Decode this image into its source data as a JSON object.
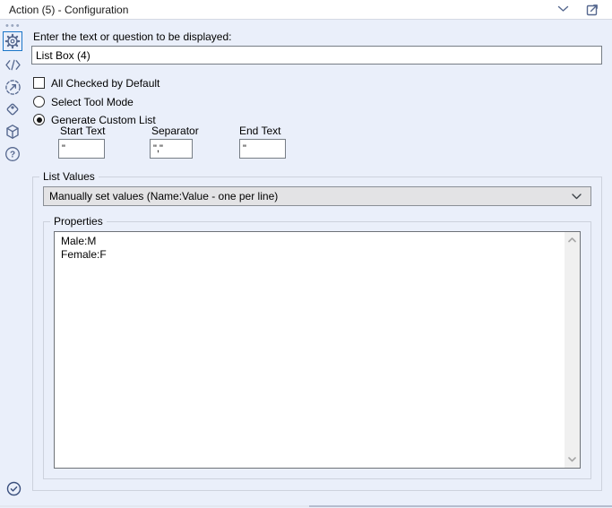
{
  "colors": {
    "panel_bg": "#eaeffa",
    "selected_tab_border": "#1b76c8",
    "sidebar_icon": "#56688f",
    "dropdown_bg": "#e3e3e5"
  },
  "header": {
    "title": "Action (5) - Configuration",
    "icons": [
      "chevron-down",
      "popout-window"
    ]
  },
  "sidebar": {
    "icons": [
      "grip-dots",
      "gear",
      "code",
      "run-arrow",
      "tag",
      "package",
      "help"
    ],
    "selected_icon": "gear"
  },
  "question": {
    "label": "Enter the text or question to be displayed:",
    "value": "List Box (4)"
  },
  "options": {
    "all_checked": {
      "label": "All Checked by Default",
      "checked": false
    },
    "select_tool_mode": {
      "label": "Select Tool Mode",
      "selected": false
    },
    "generate_custom_list": {
      "label": "Generate Custom List",
      "selected": true
    }
  },
  "custom_list_fields": [
    {
      "label": "Start Text",
      "value": "\""
    },
    {
      "label": "Separator",
      "value": "\",\""
    },
    {
      "label": "End Text",
      "value": "\""
    }
  ],
  "list_values": {
    "group_label": "List Values",
    "dropdown_value": "Manually set values (Name:Value - one per line)"
  },
  "properties": {
    "group_label": "Properties",
    "text": "Male:M\nFemale:F"
  }
}
